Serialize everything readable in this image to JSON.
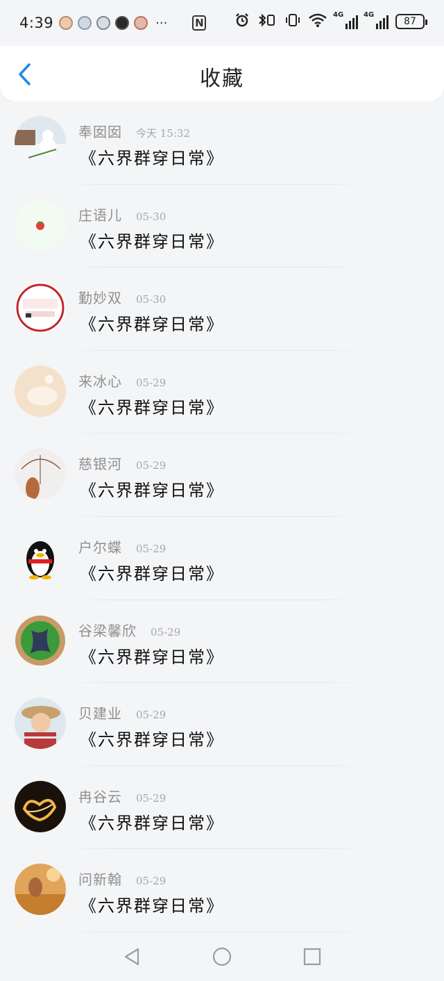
{
  "status_bar": {
    "time": "4:39",
    "more": "···",
    "nfc": "N",
    "battery": "87",
    "network": [
      "4G",
      "4G"
    ]
  },
  "header": {
    "title": "收藏",
    "back_icon": "chevron-left-icon",
    "accent_color": "#1e8ae6"
  },
  "favorites": [
    {
      "name": "奉囡囡",
      "date": "今天 15:32",
      "content": "《六界群穿日常》",
      "avatar": "snowman-photo"
    },
    {
      "name": "庄语儿",
      "date": "05-30",
      "content": "《六界群穿日常》",
      "avatar": "tomato-icon"
    },
    {
      "name": "勤妙双",
      "date": "05-30",
      "content": "《六界群穿日常》",
      "avatar": "red-stamp-badge"
    },
    {
      "name": "来冰心",
      "date": "05-29",
      "content": "《六界群穿日常》",
      "avatar": "cream-photo"
    },
    {
      "name": "慈银河",
      "date": "05-29",
      "content": "《六界群穿日常》",
      "avatar": "umbrella-sketch"
    },
    {
      "name": "户尔蝶",
      "date": "05-29",
      "content": "《六界群穿日常》",
      "avatar": "penguin-icon"
    },
    {
      "name": "谷梁馨欣",
      "date": "05-29",
      "content": "《六界群穿日常》",
      "avatar": "green-emblem"
    },
    {
      "name": "贝建业",
      "date": "05-29",
      "content": "《六界群穿日常》",
      "avatar": "child-photo"
    },
    {
      "name": "冉谷云",
      "date": "05-29",
      "content": "《六界群穿日常》",
      "avatar": "light-heart-photo"
    },
    {
      "name": "问新翰",
      "date": "05-29",
      "content": "《六界群穿日常》",
      "avatar": "golden-photo"
    }
  ],
  "nav_bar": {
    "back_icon": "triangle-back-icon",
    "home_icon": "circle-home-icon",
    "recents_icon": "square-recents-icon"
  }
}
